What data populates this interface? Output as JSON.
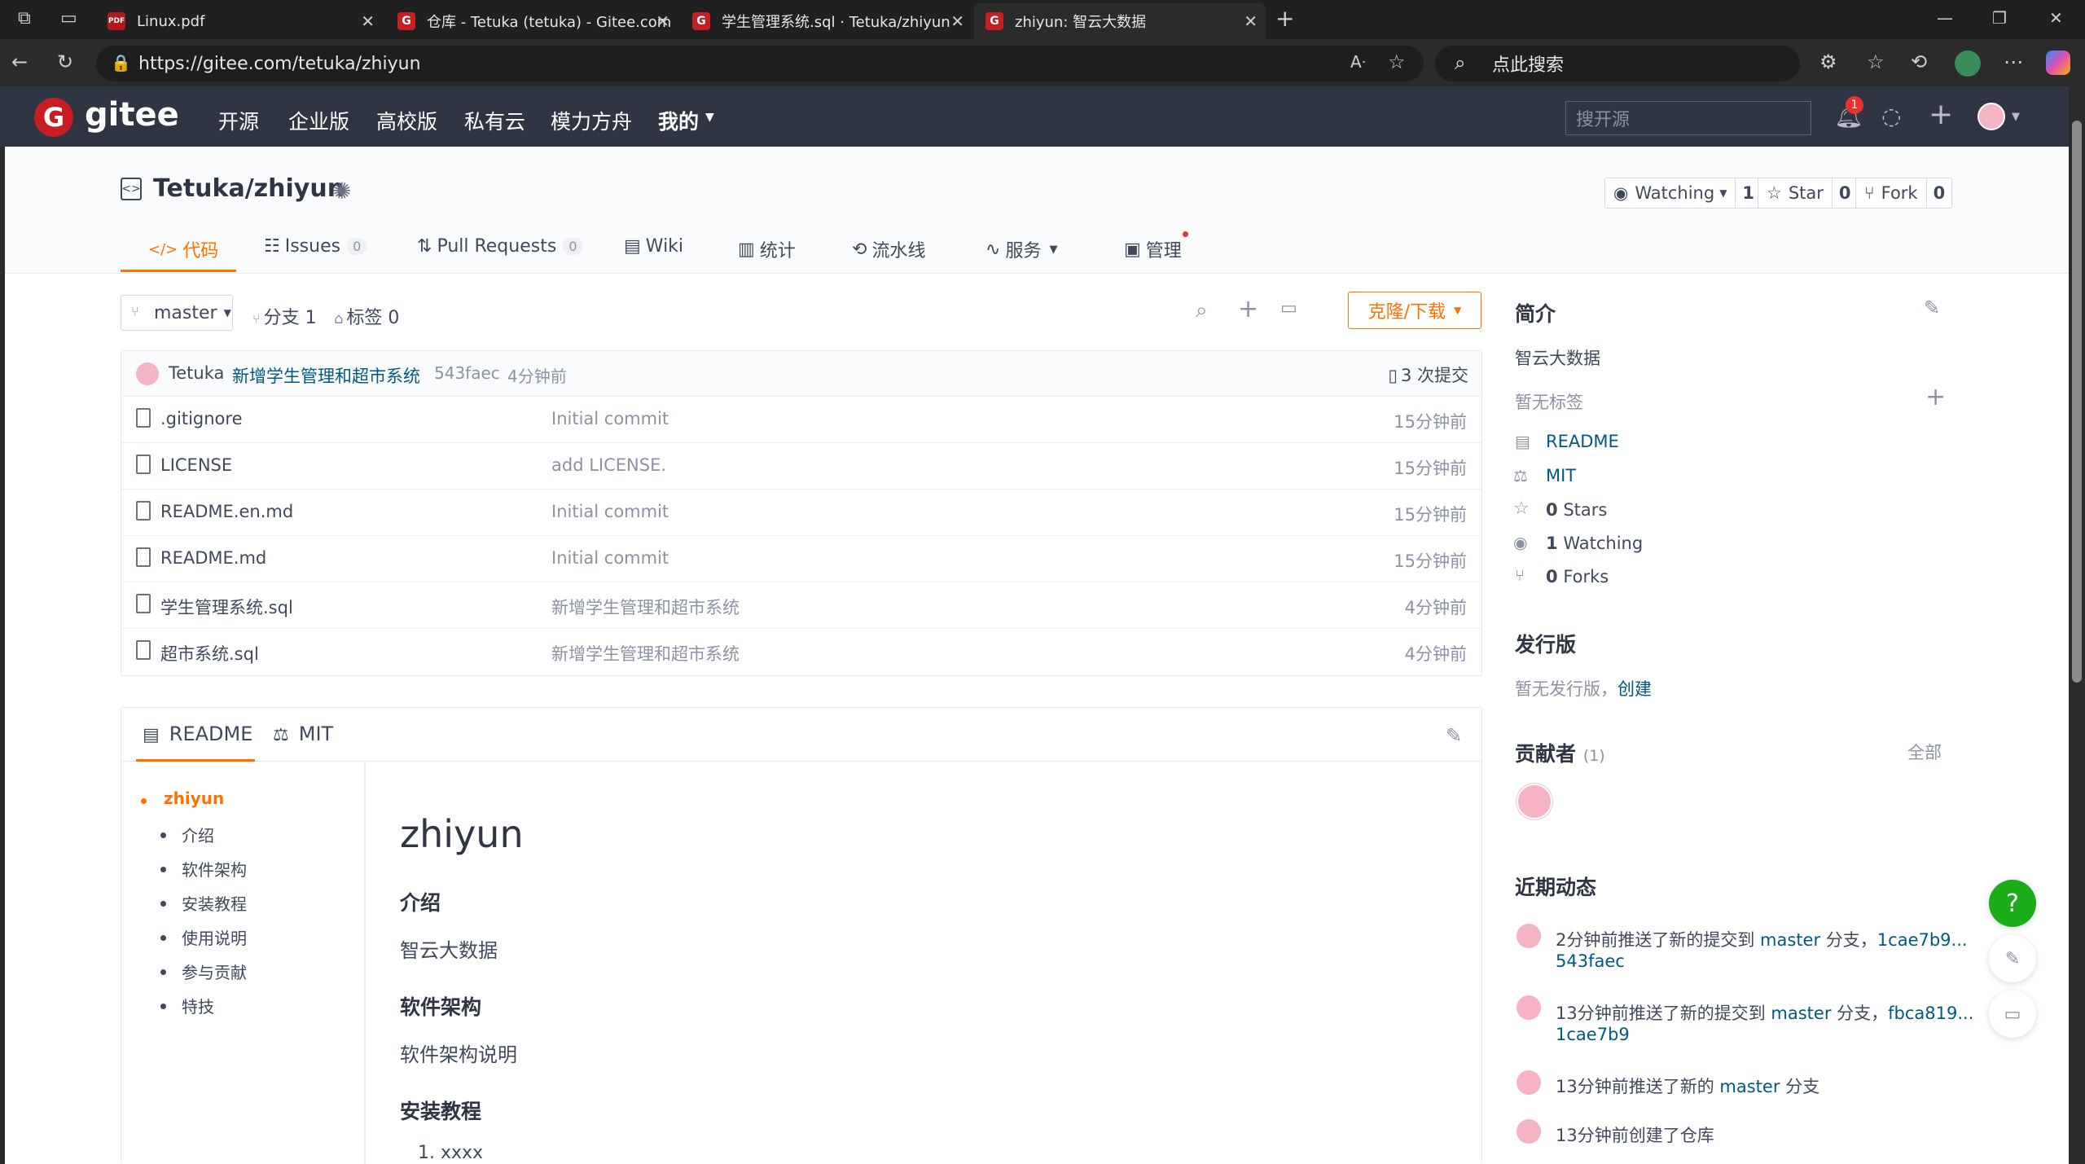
{
  "browser": {
    "tabs": [
      {
        "title": "Linux.pdf",
        "icon": "pdf-icon"
      },
      {
        "title": "仓库 - Tetuka (tetuka) - Gitee.com",
        "icon": "gitee-icon"
      },
      {
        "title": "学生管理系统.sql · Tetuka/zhiyun",
        "icon": "gitee-icon"
      },
      {
        "title": "zhiyun: 智云大数据",
        "icon": "gitee-icon"
      }
    ],
    "url": "https://gitee.com/tetuka/zhiyun",
    "search_placeholder": "点此搜索"
  },
  "gitee": {
    "logo_text": "gitee",
    "nav": [
      "开源",
      "企业版",
      "高校版",
      "私有云",
      "模力方舟",
      "我的"
    ],
    "search_placeholder": "搜开源",
    "notification_count": "1"
  },
  "repo": {
    "title": "Tetuka/zhiyun",
    "watching_label": "Watching",
    "watching_count": "1",
    "star_label": "Star",
    "star_count": "0",
    "fork_label": "Fork",
    "fork_count": "0",
    "tabs": [
      {
        "label": "代码"
      },
      {
        "label": "Issues",
        "count": "0"
      },
      {
        "label": "Pull Requests",
        "count": "0"
      },
      {
        "label": "Wiki"
      },
      {
        "label": "统计"
      },
      {
        "label": "流水线"
      },
      {
        "label": "服务"
      },
      {
        "label": "管理"
      }
    ],
    "branch": "master",
    "branches_label": "分支 1",
    "tags_label": "标签 0",
    "clone_label": "克隆/下载"
  },
  "commit": {
    "author": "Tetuka",
    "message": "新增学生管理和超市系统",
    "hash": "543faec",
    "time": "4分钟前",
    "commits_label": "3 次提交"
  },
  "files": [
    {
      "name": ".gitignore",
      "message": "Initial commit",
      "time": "15分钟前"
    },
    {
      "name": "LICENSE",
      "message": "add LICENSE.",
      "time": "15分钟前"
    },
    {
      "name": "README.en.md",
      "message": "Initial commit",
      "time": "15分钟前"
    },
    {
      "name": "README.md",
      "message": "Initial commit",
      "time": "15分钟前"
    },
    {
      "name": "学生管理系统.sql",
      "message": "新增学生管理和超市系统",
      "time": "4分钟前"
    },
    {
      "name": "超市系统.sql",
      "message": "新增学生管理和超市系统",
      "time": "4分钟前"
    }
  ],
  "readme": {
    "tabs": [
      "README",
      "MIT"
    ],
    "toc_top": "zhiyun",
    "toc": [
      "介绍",
      "软件架构",
      "安装教程",
      "使用说明",
      "参与贡献",
      "特技"
    ],
    "h1": "zhiyun",
    "sections": [
      {
        "heading": "介绍",
        "body": "智云大数据"
      },
      {
        "heading": "软件架构",
        "body": "软件架构说明"
      },
      {
        "heading": "安装教程",
        "body": "1. xxxx"
      }
    ]
  },
  "sidebar": {
    "intro_title": "简介",
    "intro_text": "智云大数据",
    "no_tags": "暂无标签",
    "links": [
      {
        "label": "README",
        "icon": "book-icon"
      },
      {
        "label": "MIT",
        "icon": "scale-icon"
      }
    ],
    "stats": [
      {
        "num": "0",
        "label": "Stars",
        "icon": "star-icon"
      },
      {
        "num": "1",
        "label": "Watching",
        "icon": "eye-icon"
      },
      {
        "num": "0",
        "label": "Forks",
        "icon": "fork-icon"
      }
    ],
    "release_title": "发行版",
    "release_text": "暂无发行版，",
    "release_link": "创建",
    "contrib_title": "贡献者",
    "contrib_count": "(1)",
    "contrib_all": "全部",
    "activity_title": "近期动态",
    "activities": [
      {
        "line1_a": "2分钟前推送了新的提交到 ",
        "line1_link": "master",
        "line1_b": " 分支，",
        "line1_hash": "1cae7b9...",
        "line2": "543faec"
      },
      {
        "line1_a": "13分钟前推送了新的提交到 ",
        "line1_link": "master",
        "line1_b": " 分支，",
        "line1_hash": "fbca819...",
        "line2": "1cae7b9"
      },
      {
        "line1_a": "13分钟前推送了新的 ",
        "line1_link": "master",
        "line1_b": " 分支",
        "line1_hash": "",
        "line2": ""
      },
      {
        "line1_a": "13分钟前创建了仓库",
        "line1_link": "",
        "line1_b": "",
        "line1_hash": "",
        "line2": ""
      }
    ]
  },
  "colors": {
    "accent": "#fe7300",
    "header_bg": "#2f3542",
    "link": "#005980",
    "brand_red": "#c71d23"
  }
}
